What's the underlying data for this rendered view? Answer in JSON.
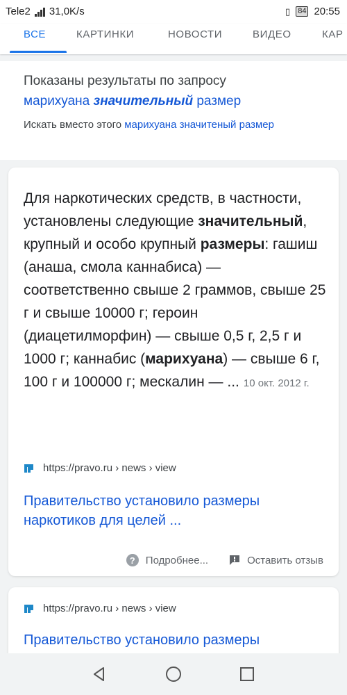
{
  "status": {
    "carrier": "Tele2",
    "speed": "31,0K/s",
    "battery": "84",
    "time": "20:55"
  },
  "tabs": [
    {
      "label": "ВСЕ",
      "active": true
    },
    {
      "label": "КАРТИНКИ",
      "active": false
    },
    {
      "label": "НОВОСТИ",
      "active": false
    },
    {
      "label": "ВИДЕО",
      "active": false
    },
    {
      "label": "КАР",
      "active": false
    }
  ],
  "showing": {
    "prefix": "Показаны результаты по запросу",
    "query_part1": "марихуана",
    "query_bold": "значительный",
    "query_part2": "размер",
    "instead_prefix": "Искать вместо этого",
    "instead_query": "марихуана значитеный размер"
  },
  "featured": {
    "snippet_parts": [
      {
        "text": "Для наркотических средств, в частности, установлены следующие ",
        "bold": false
      },
      {
        "text": "значительный",
        "bold": true
      },
      {
        "text": ", крупный и особо крупный ",
        "bold": false
      },
      {
        "text": "размеры",
        "bold": true
      },
      {
        "text": ": гашиш (анаша, смола каннабиса) — соответственно свыше 2 граммов, свыше 25 г и свыше 10000 г; героин (диацетилморфин) — свыше 0,5 г, 2,5 г и 1000 г; каннабис (",
        "bold": false
      },
      {
        "text": "марихуана",
        "bold": true
      },
      {
        "text": ") — свыше 6 г, 100 г и 100000 г; мескалин — ...",
        "bold": false
      }
    ],
    "date": "10 окт. 2012 г.",
    "source_url": "https://pravo.ru › news › view",
    "title": "Правительство установило размеры наркотиков для целей ...",
    "more_label": "Подробнее...",
    "feedback_label": "Оставить отзыв"
  },
  "result2": {
    "source_url": "https://pravo.ru › news › view",
    "title": "Правительство установило размеры"
  },
  "colors": {
    "link": "#1558d6",
    "tab_active": "#1a73e8",
    "text": "#202124"
  }
}
